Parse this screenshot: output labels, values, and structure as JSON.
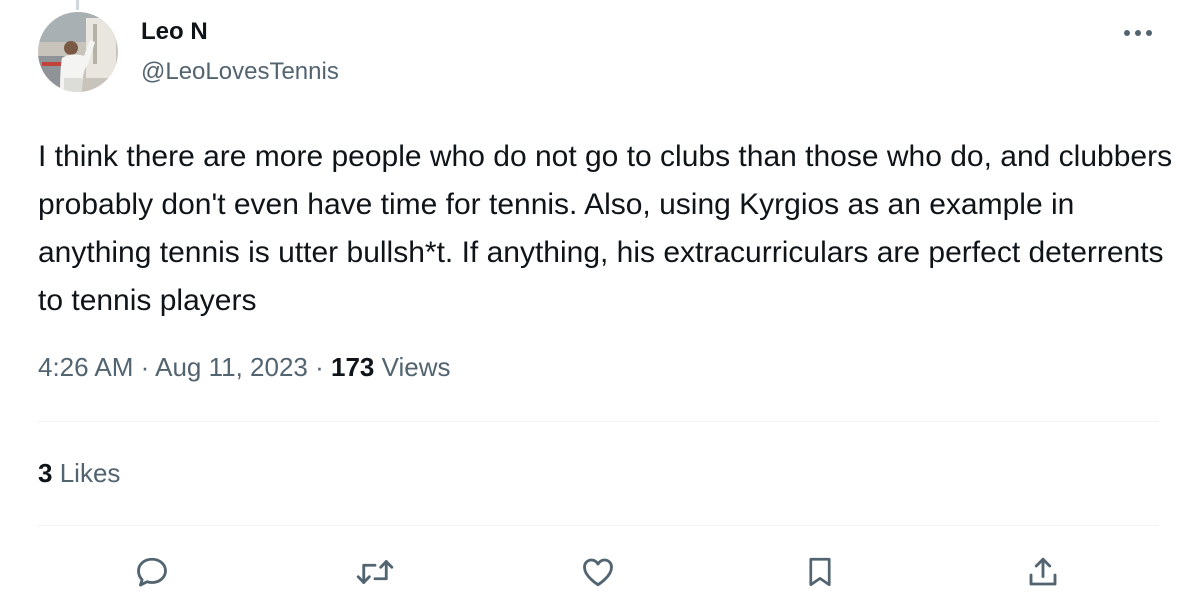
{
  "tweet": {
    "author_name": "Leo N",
    "author_handle": "@LeoLovesTennis",
    "text": "I think there are more people who do not go to clubs than those who do, and clubbers probably don't even have time for tennis. Also, using Kyrgios as an example in anything tennis is utter bullsh*t. If anything, his extracurriculars are perfect deterrents to tennis players",
    "time": "4:26 AM",
    "separator": "·",
    "date": "Aug 11, 2023",
    "views_count": "173",
    "views_label": "Views",
    "likes_count": "3",
    "likes_label": "Likes"
  },
  "icons": {
    "more": "more-horizontal-icon",
    "reply": "reply-icon",
    "retweet": "retweet-icon",
    "like": "heart-icon",
    "bookmark": "bookmark-icon",
    "share": "share-icon"
  },
  "colors": {
    "text": "#0f1419",
    "secondary": "#536471",
    "divider": "#eff3f4"
  }
}
